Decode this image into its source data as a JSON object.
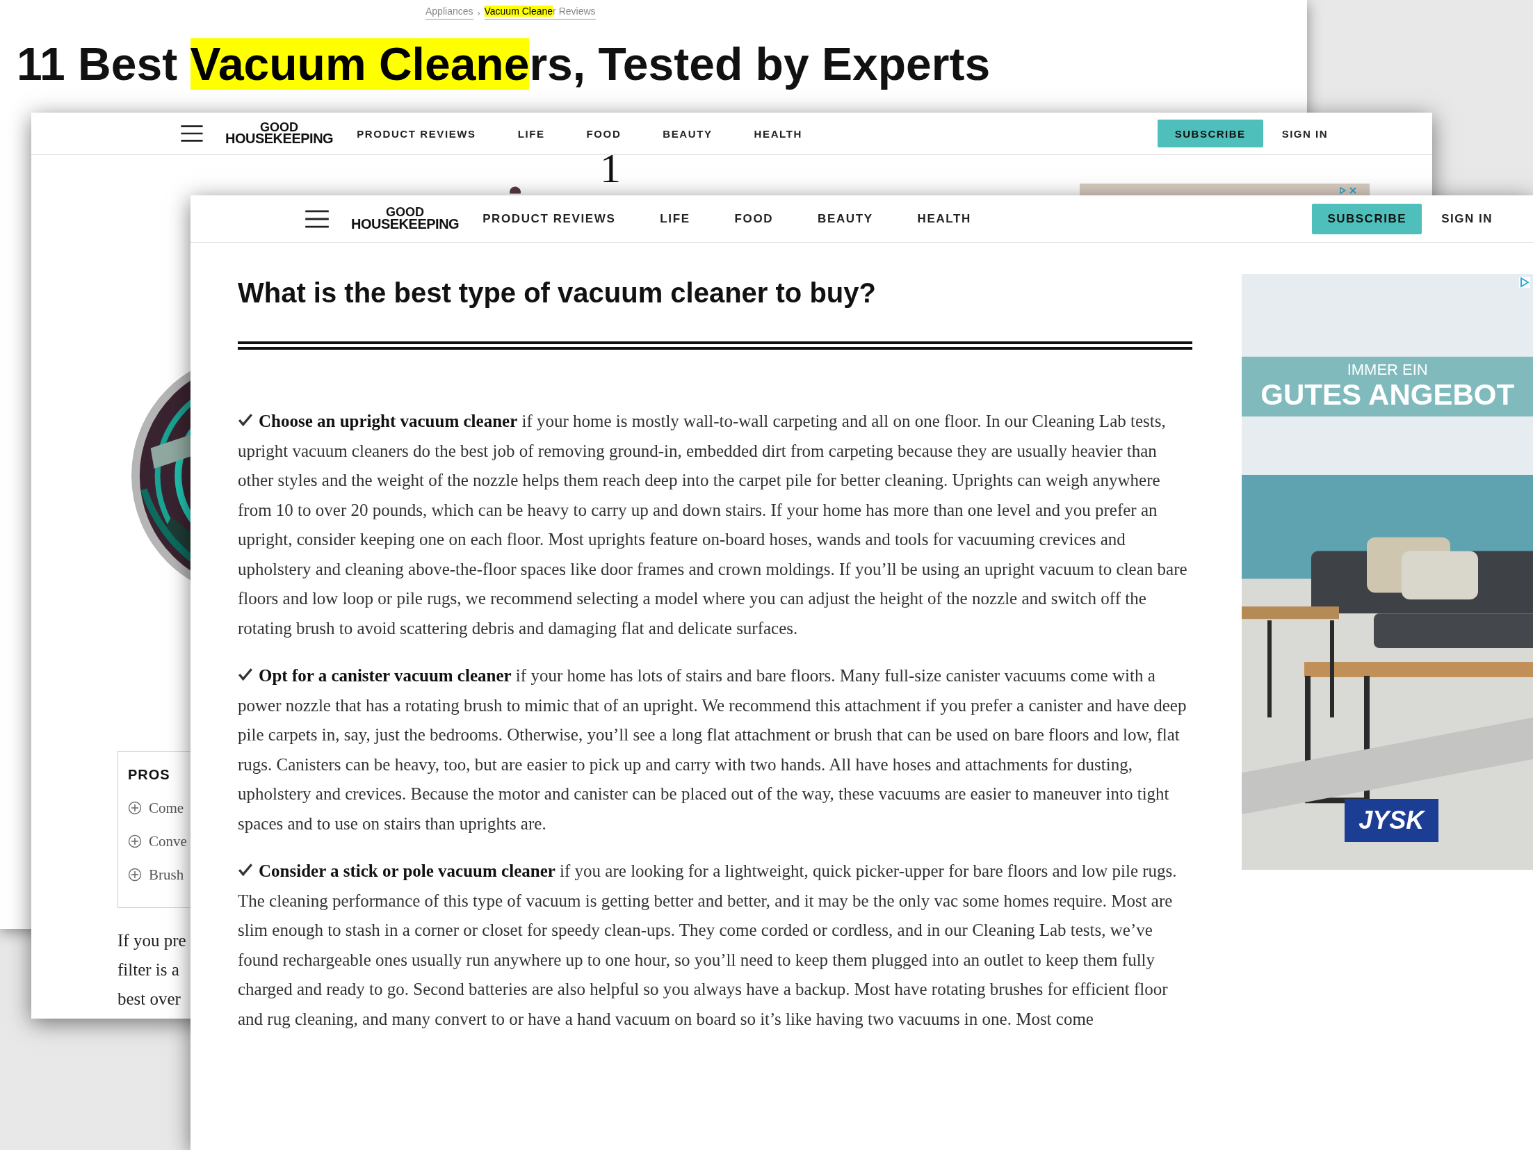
{
  "back_page": {
    "breadcrumb": [
      {
        "parts": [
          {
            "text": "Appliances",
            "highlighted": false
          }
        ]
      },
      {
        "parts": [
          {
            "text": "Vacuum Cleane",
            "highlighted": true
          },
          {
            "text": "r Reviews",
            "highlighted": false
          }
        ]
      }
    ],
    "breadcrumb_separator": "›",
    "title": [
      {
        "text": "11 Best ",
        "highlighted": false
      },
      {
        "text": "Vacuum Cleane",
        "highlighted": true
      },
      {
        "text": "rs, Tested by Experts",
        "highlighted": false
      }
    ]
  },
  "middle_page": {
    "nav": {
      "logo": [
        "GOOD",
        "HOUSEKEEPING"
      ],
      "links": [
        "PRODUCT REVIEWS",
        "LIFE",
        "FOOD",
        "BEAUTY",
        "HEALTH"
      ],
      "subscribe": "SUBSCRIBE",
      "sign_in": "SIGN IN"
    },
    "heading_fragment": "1",
    "pros": {
      "title": "PROS",
      "items": [
        "Come",
        "Conve",
        "Brush"
      ]
    },
    "text_fragments": [
      "If you pre",
      "filter is a",
      "best over"
    ]
  },
  "front_page": {
    "nav": {
      "logo": [
        "GOOD",
        "HOUSEKEEPING"
      ],
      "links": [
        "PRODUCT REVIEWS",
        "LIFE",
        "FOOD",
        "BEAUTY",
        "HEALTH"
      ],
      "subscribe": "SUBSCRIBE",
      "sign_in": "SIGN IN"
    },
    "heading": "What is the best type of vacuum cleaner to buy?",
    "paragraphs": [
      "**Choose an upright vacuum cleaner** if your home is mostly wall-to-wall carpeting and all on one floor. In our Cleaning Lab tests, upright vacuum cleaners do the best job of removing ground-in, embedded dirt from carpeting because they are usually heavier than other styles and the weight of the nozzle helps them reach deep into the carpet pile for better cleaning. Uprights can weigh anywhere from 10 to over 20 pounds, which can be heavy to carry up and down stairs. If your home has more than one level and you prefer an upright, consider keeping one on each floor. Most uprights feature on-board hoses, wands and tools for vacuuming crevices and upholstery and cleaning above-the-floor spaces like door frames and crown moldings. If you’ll be using an upright vacuum to clean bare floors and low loop or pile rugs, we recommend selecting a model where you can adjust the height of the nozzle and switch off the rotating brush to avoid scattering debris and damaging flat and delicate surfaces.",
      "**Opt for a canister vacuum cleaner** if your home has lots of stairs and bare floors. Many full-size canister vacuums come with a power nozzle that has a rotating brush to mimic that of an upright. We recommend this attachment if you prefer a canister and have deep pile carpets in, say, just the bedrooms. Otherwise, you’ll see a long flat attachment or brush that can be used on bare floors and low, flat rugs. Canisters can be heavy, too, but are easier to pick up and carry with two hands. All have hoses and attachments for dusting, upholstery and crevices. Because the motor and canister can be placed out of the way, these vacuums are easier to maneuver into tight spaces and to use on stairs than uprights are.",
      "**Consider a stick or pole vacuum cleaner** if you are looking for a lightweight, quick picker-upper for bare floors and low pile rugs. The cleaning performance of this type of vacuum is getting better and better, and it may be the only vac some homes require. Most are slim enough to stash in a corner or closet for speedy clean-ups. They come corded or cordless, and in our Cleaning Lab tests, we’ve found rechargeable ones usually run anywhere up to one hour, so you’ll need to keep them plugged into an outlet to keep them fully charged and ready to go. Second batteries are also helpful so you always have a backup. Most have rotating brushes for efficient floor and rug cleaning, and many convert to or have a hand vacuum on board so it’s like having two vacuums in one. Most come"
    ],
    "ad": {
      "kicker": "IMMER EIN",
      "headline": "GUTES ANGEBOT",
      "brand": "JYSK"
    }
  }
}
